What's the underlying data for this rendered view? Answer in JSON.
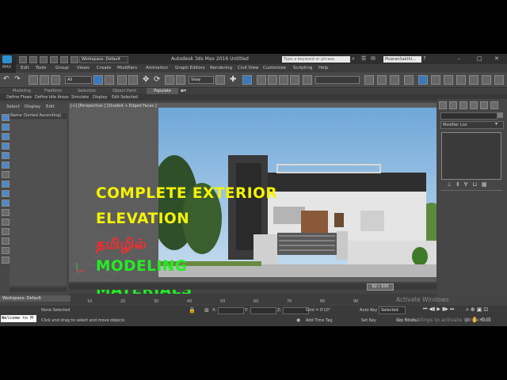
{
  "window": {
    "title": "Autodesk 3ds Max 2016     Untitled",
    "workspace": "Workspace: Default",
    "search_placeholder": "Type a keyword or phrase",
    "user": "PiceranSakthi..."
  },
  "menu": [
    "Edit",
    "Tools",
    "Group",
    "Views",
    "Create",
    "Modifiers",
    "Animation",
    "Graph Editors",
    "Rendering",
    "Civil View",
    "Customize",
    "Scripting",
    "Help"
  ],
  "toolbar": {
    "selection_filter": "All",
    "view_dropdown": "View"
  },
  "ribbon": {
    "tabs": [
      "Modeling",
      "Freeform",
      "Selection",
      "Object Paint"
    ],
    "populate": "Populate",
    "tools": [
      "Define Flows",
      "Define Idle Areas",
      "Simulate",
      "Display",
      "Edit Selected"
    ]
  },
  "scene_explorer": {
    "tabs": [
      "Select",
      "Display",
      "Edit"
    ],
    "column_header": "Name (Sorted Ascending)"
  },
  "viewport": {
    "label": "[+] [Perspective ] [Shaded + Edged Faces ]",
    "headline": [
      "COMPLETE EXTERIOR",
      "ELEVATION",
      "தமிழில்",
      "MODELING",
      "MATERIALS"
    ],
    "colors": {
      "yellow": "#f4f400",
      "green": "#22ee22",
      "red": "#ff2a2a"
    }
  },
  "command_panel": {
    "modifier_list": "Modifier List"
  },
  "timeline": {
    "frame": "92 / 100",
    "ticks": [
      "10",
      "20",
      "30",
      "40",
      "50",
      "60",
      "70",
      "80",
      "90"
    ]
  },
  "status": {
    "workspace": "Workspace: Default",
    "maxscript": "Welcome to M",
    "selection": "None Selected",
    "prompt": "Click and drag to select and move objects",
    "x_label": "X:",
    "y_label": "Y:",
    "z_label": "Z:",
    "grid": "Grid = 0'10\"",
    "add_time_tag": "Add Time Tag",
    "auto_key": "Auto Key",
    "auto_key_value": "Selected",
    "set_key": "Set Key",
    "key_filters": "Key Filters..."
  },
  "watermark": {
    "line1": "Activate Windows",
    "line2": "Go to Settings to activate Windows."
  }
}
